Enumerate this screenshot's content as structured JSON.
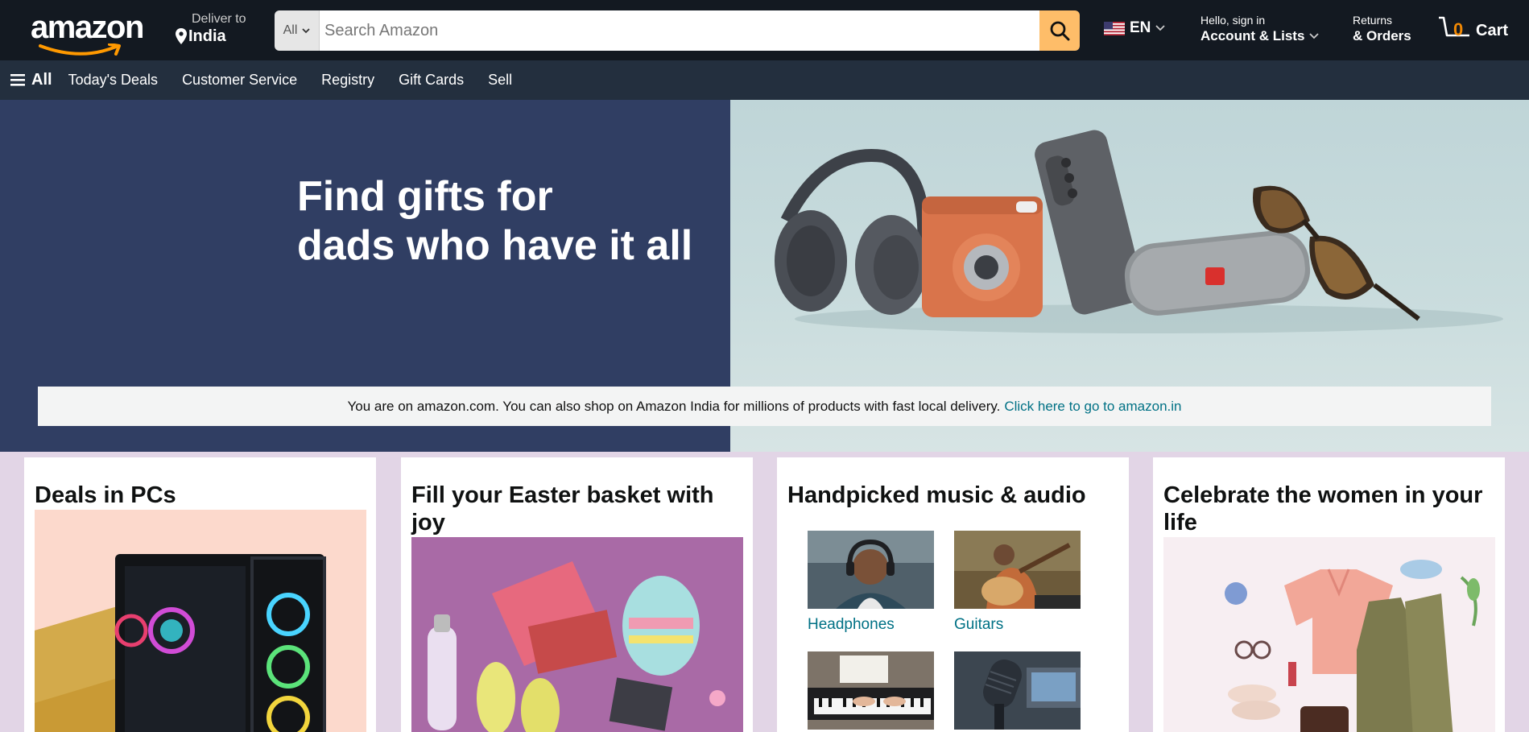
{
  "header": {
    "logo_text": "amazon",
    "deliver_label": "Deliver to",
    "deliver_location": "India",
    "search_category": "All",
    "search_placeholder": "Search Amazon",
    "language": "EN",
    "account_greeting": "Hello, sign in",
    "account_label": "Account & Lists",
    "returns_label": "Returns",
    "orders_label": "& Orders",
    "cart_count": "0",
    "cart_label": "Cart"
  },
  "subnav": {
    "all_label": "All",
    "links": [
      "Today's Deals",
      "Customer Service",
      "Registry",
      "Gift Cards",
      "Sell"
    ]
  },
  "hero": {
    "title_line1": "Find gifts for",
    "title_line2": "dads who have it all"
  },
  "notice": {
    "text": "You are on amazon.com. You can also shop on Amazon India for millions of products with fast local delivery.",
    "link": "Click here to go to amazon.in"
  },
  "cards": [
    {
      "title": "Deals in PCs"
    },
    {
      "title": "Fill your Easter basket with joy"
    },
    {
      "title": "Handpicked music & audio",
      "tiles": [
        "Headphones",
        "Guitars",
        "",
        ""
      ]
    },
    {
      "title": "Celebrate the women in your life"
    }
  ],
  "icons": {
    "location": "location-pin-icon",
    "search": "search-icon",
    "flag": "us-flag-icon",
    "menu": "hamburger-menu-icon",
    "cart": "cart-icon"
  },
  "colors": {
    "nav_bg": "#131921",
    "subnav_bg": "#232f3e",
    "search_button": "#febd69",
    "hero_left": "#303e63",
    "link": "#007185",
    "cart_count": "#f08804",
    "cards_bg": "#e2d5e6"
  }
}
